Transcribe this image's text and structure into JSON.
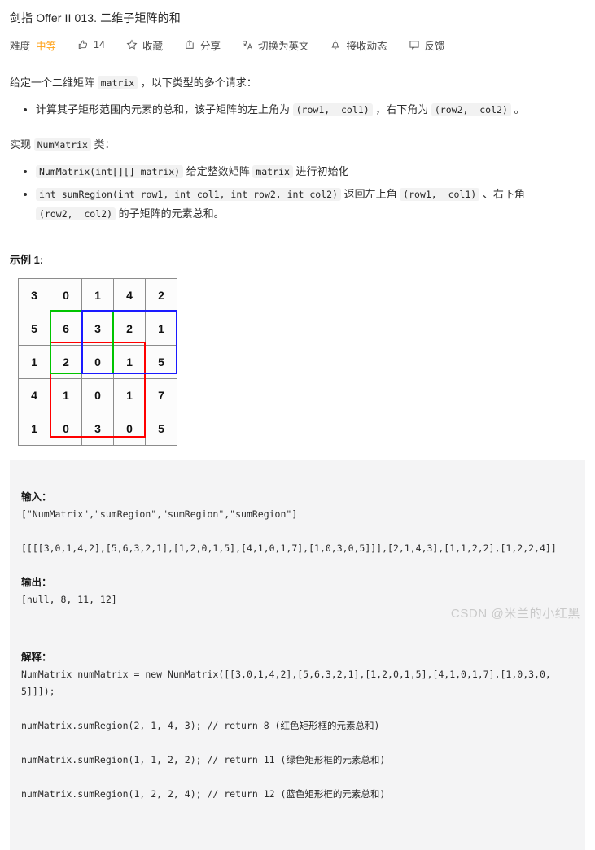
{
  "problem": {
    "title": "剑指 Offer II 013. 二维子矩阵的和"
  },
  "meta": {
    "difficulty_label": "难度",
    "difficulty_value": "中等",
    "difficulty_color": "#ffa116",
    "likes": "14",
    "favorite": "收藏",
    "share": "分享",
    "translate": "切换为英文",
    "subscribe": "接收动态",
    "feedback": "反馈"
  },
  "description": {
    "intro_1": "给定一个二维矩阵 ",
    "intro_code": "matrix",
    "intro_2": " ，以下类型的多个请求：",
    "bullet_1_a": "计算其子矩形范围内元素的总和，该子矩阵的左上角为 ",
    "bullet_1_code1": "(row1,  col1)",
    "bullet_1_b": " ，右下角为 ",
    "bullet_1_code2": "(row2,  col2)",
    "bullet_1_c": " 。",
    "impl_1": "实现 ",
    "impl_code": "NumMatrix",
    "impl_2": " 类：",
    "bullet_2_code": "NumMatrix(int[][] matrix)",
    "bullet_2_a": " 给定整数矩阵 ",
    "bullet_2_code2": "matrix",
    "bullet_2_b": " 进行初始化",
    "bullet_3_code": "int sumRegion(int row1, int col1, int row2, int col2)",
    "bullet_3_a": " 返回左上角 ",
    "bullet_3_code2": "(row1,  col1)",
    "bullet_3_b": " 、右下角 ",
    "bullet_3_code3": "(row2,  col2)",
    "bullet_3_c": " 的子矩阵的元素总和。"
  },
  "example": {
    "heading": "示例 1:",
    "matrix": [
      [
        3,
        0,
        1,
        4,
        2
      ],
      [
        5,
        6,
        3,
        2,
        1
      ],
      [
        1,
        2,
        0,
        1,
        5
      ],
      [
        4,
        1,
        0,
        1,
        7
      ],
      [
        1,
        0,
        3,
        0,
        5
      ]
    ],
    "highlight_rects": [
      {
        "name": "red-rect",
        "color": "#ff0000",
        "row1": 2,
        "col1": 1,
        "row2": 4,
        "col2": 3,
        "sum": 8
      },
      {
        "name": "green-rect",
        "color": "#00c400",
        "row1": 1,
        "col1": 1,
        "row2": 2,
        "col2": 2,
        "sum": 11
      },
      {
        "name": "blue-rect",
        "color": "#1a1aff",
        "row1": 1,
        "col1": 2,
        "row2": 2,
        "col2": 4,
        "sum": 12
      }
    ],
    "input_label": "输入：",
    "input_line_1": "[\"NumMatrix\",\"sumRegion\",\"sumRegion\",\"sumRegion\"]",
    "input_line_2": "[[[[3,0,1,4,2],[5,6,3,2,1],[1,2,0,1,5],[4,1,0,1,7],[1,0,3,0,5]]],[2,1,4,3],[1,1,2,2],[1,2,2,4]]",
    "output_label": "输出：",
    "output_line": "[null, 8, 11, 12]",
    "explain_label": "解释：",
    "explain_line_1": "NumMatrix numMatrix = new NumMatrix([[3,0,1,4,2],[5,6,3,2,1],[1,2,0,1,5],[4,1,0,1,7],[1,0,3,0,5]]]);",
    "explain_line_2": "numMatrix.sumRegion(2, 1, 4, 3); // return 8 (红色矩形框的元素总和)",
    "explain_line_3": "numMatrix.sumRegion(1, 1, 2, 2); // return 11 (绿色矩形框的元素总和)",
    "explain_line_4": "numMatrix.sumRegion(1, 2, 2, 4); // return 12 (蓝色矩形框的元素总和)"
  },
  "watermark": "CSDN @米兰的小红黑"
}
